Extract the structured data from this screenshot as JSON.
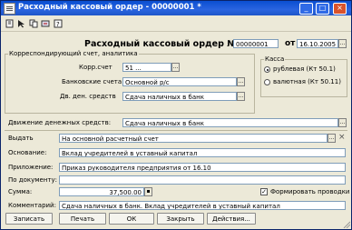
{
  "window": {
    "title": "Расходный кассовый ордер - 00000001 *",
    "minimize": "_",
    "maximize": "□",
    "close": "×"
  },
  "toolbar": [
    "print-preview",
    "cursor-select",
    "copy-doc",
    "sync",
    "help"
  ],
  "header": {
    "doc_title": "Расходный кассовый ордер №",
    "number": "00000001",
    "date_label": "от",
    "date": "16.10.2005"
  },
  "corr": {
    "group_label": "Корреспондирующий счет, аналитика",
    "account_label": "Корр.счет",
    "account_value": "51 ...",
    "bank_label": "Банковские счета",
    "bank_value": "Основной р/с",
    "cash_label": "Дв. ден. средств",
    "cash_value": "Сдача наличных в банк"
  },
  "kassa": {
    "group_label": "Касса",
    "options": [
      "рублевая (Кт 50.1)",
      "валютная (Кт 50.11)"
    ],
    "selected": 0
  },
  "movement": {
    "label": "Движение денежных средств:",
    "value": "Сдача наличных в банк"
  },
  "issue": {
    "label": "Выдать",
    "value": "На основной расчетный счет"
  },
  "basis": {
    "label": "Основание:",
    "value": "Вклад учредителей в уставный капитал"
  },
  "attachment": {
    "label": "Приложение:",
    "value": "Приказ руководителя предприятия от 16.10"
  },
  "by_document": {
    "label": "По документу:",
    "value": ""
  },
  "amount": {
    "label": "Сумма:",
    "value": "37,500.00"
  },
  "post_entries": {
    "label": "Формировать проводки",
    "checked": true
  },
  "comment": {
    "label": "Комментарий:",
    "value": "Сдача наличных в банк. Вклад учредителей в уставный капитал"
  },
  "buttons": {
    "save": "Записать",
    "print": "Печать",
    "ok": "ОК",
    "close": "Закрыть",
    "actions": "Действия..."
  }
}
